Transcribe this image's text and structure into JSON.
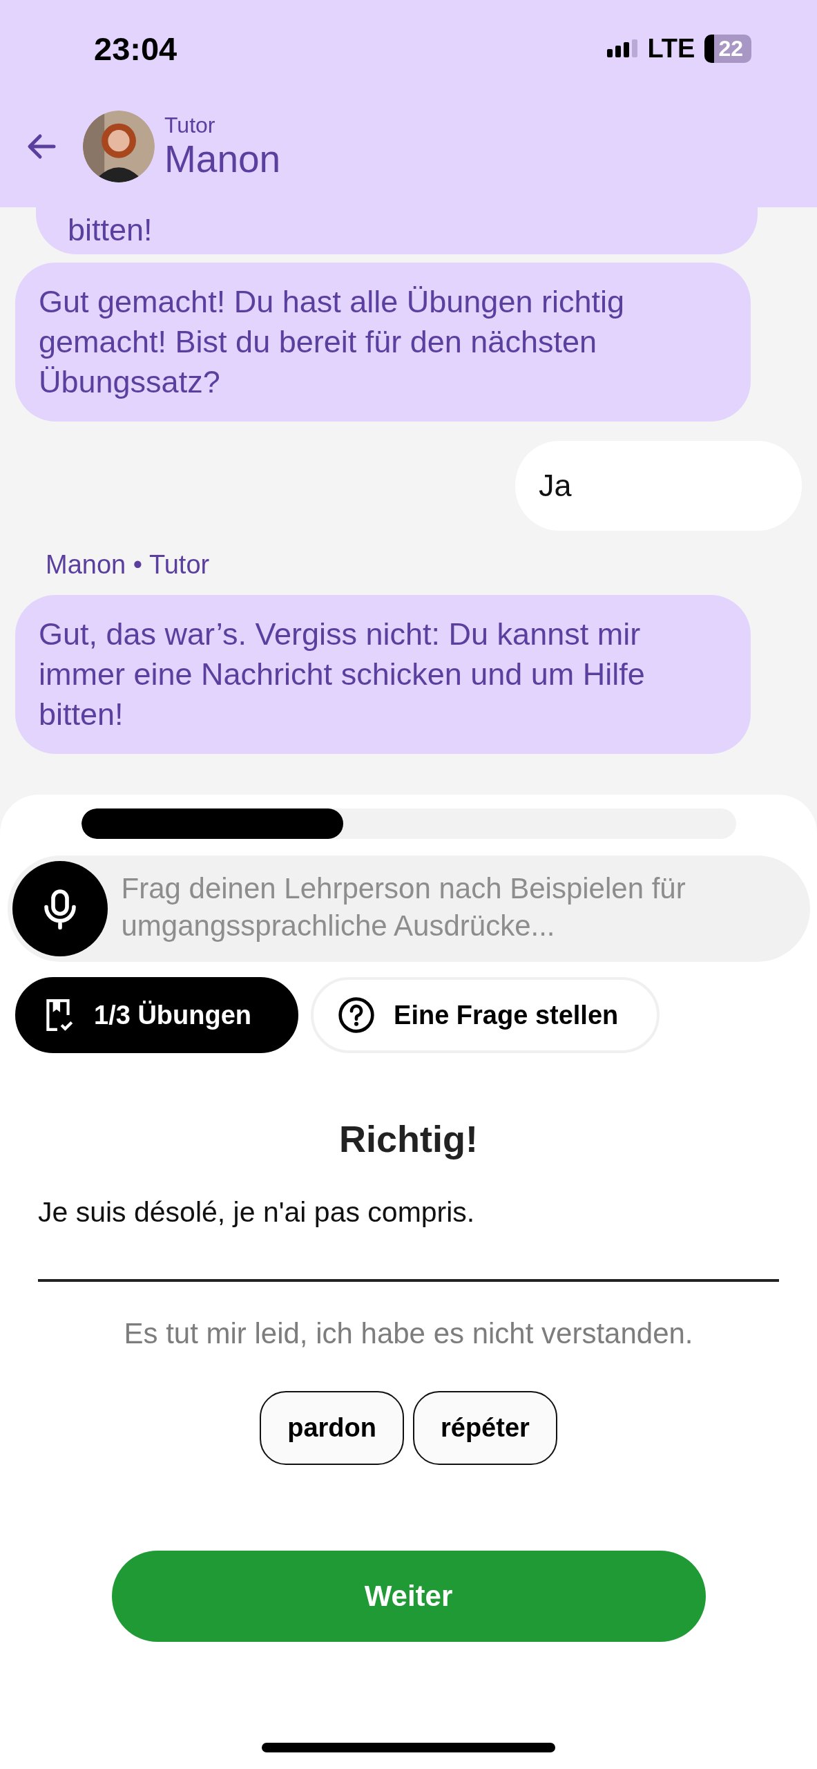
{
  "status_bar": {
    "time": "23:04",
    "network": "LTE",
    "battery": "22"
  },
  "header": {
    "subtitle": "Tutor",
    "name": "Manon"
  },
  "messages": [
    {
      "kind": "tutor",
      "text": "bitten!"
    },
    {
      "kind": "tutor",
      "text": "Gut gemacht! Du hast alle Übungen richtig gemacht! Bist du bereit für den nächsten Übungssatz?"
    },
    {
      "kind": "user",
      "text": "Ja"
    },
    {
      "kind": "sender",
      "text": "Manon • Tutor"
    },
    {
      "kind": "tutor",
      "text": "Gut, das war’s. Vergiss nicht: Du kannst mir immer eine Nachricht schicken und um Hilfe bitten!"
    }
  ],
  "progress": {
    "level": 0.4
  },
  "composer": {
    "placeholder": "Frag deinen Lehrperson nach Beispielen für umgangssprachliche Ausdrücke..."
  },
  "actions": [
    {
      "kind": "exercises",
      "label": "1/3 Übungen",
      "selected": true
    },
    {
      "kind": "question",
      "label": "Eine Frage stellen",
      "selected": false
    }
  ],
  "exercise": {
    "feedback": "Richtig!",
    "sentence": "Je suis désolé, je n'ai pas compris.",
    "translation": "Es tut mir leid, ich habe es nicht verstanden.",
    "words": [
      "pardon",
      "répéter"
    ]
  },
  "continue_button": "Weiter"
}
